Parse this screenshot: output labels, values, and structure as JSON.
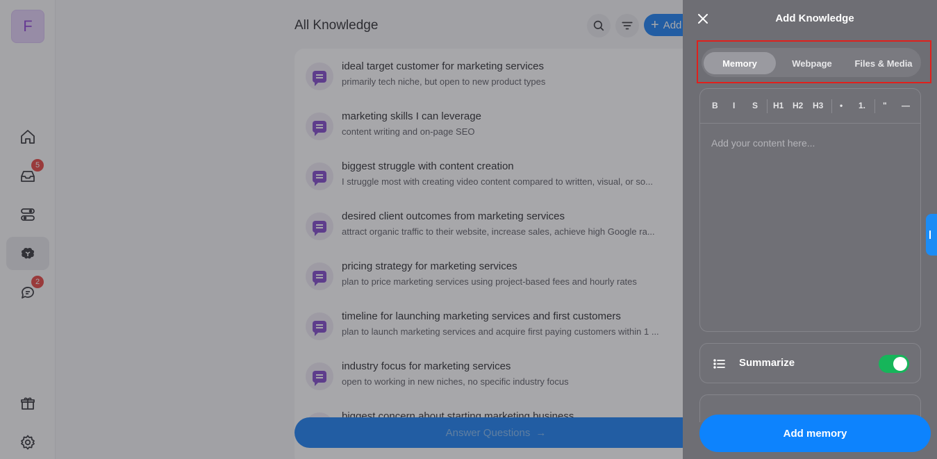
{
  "sidebar": {
    "avatar_letter": "F",
    "nav": [
      {
        "name": "home-icon",
        "badge": ""
      },
      {
        "name": "inbox-icon",
        "badge": "5"
      },
      {
        "name": "tasks-icon",
        "badge": ""
      },
      {
        "name": "brain-icon",
        "badge": "",
        "active": true
      },
      {
        "name": "chat-icon",
        "badge": "2"
      }
    ],
    "bottom": [
      {
        "name": "gift-icon"
      },
      {
        "name": "settings-icon"
      }
    ]
  },
  "main": {
    "title": "All Knowledge",
    "add_label": "Add",
    "items": [
      {
        "title": "ideal target customer for marketing services",
        "subtitle": "primarily tech niche, but open to new product types"
      },
      {
        "title": "marketing skills I can leverage",
        "subtitle": "content writing and on-page SEO"
      },
      {
        "title": "biggest struggle with content creation",
        "subtitle": "I struggle most with creating video content compared to written, visual, or so..."
      },
      {
        "title": "desired client outcomes from marketing services",
        "subtitle": "attract organic traffic to their website, increase sales, achieve high Google ra..."
      },
      {
        "title": "pricing strategy for marketing services",
        "subtitle": "plan to price marketing services using project-based fees and hourly rates"
      },
      {
        "title": "timeline for launching marketing services and first customers",
        "subtitle": "plan to launch marketing services and acquire first paying customers within 1 ..."
      },
      {
        "title": "industry focus for marketing services",
        "subtitle": "open to working in new niches, no specific industry focus"
      },
      {
        "title": "biggest concern about starting marketing business",
        "subtitle": ""
      }
    ],
    "answer_button": "Answer Questions"
  },
  "drawer": {
    "title": "Add Knowledge",
    "tabs": [
      "Memory",
      "Webpage",
      "Files & Media"
    ],
    "active_tab": "Memory",
    "toolbar": [
      "B",
      "I",
      "S",
      "H1",
      "H2",
      "H3",
      "•",
      "1.",
      "\"",
      "—"
    ],
    "placeholder": "Add your content here...",
    "summarize_label": "Summarize",
    "summarize_on": true,
    "submit_label": "Add memory"
  },
  "colors": {
    "accent": "#0d79f2",
    "toggle_on": "#16b55a",
    "highlight": "#e0201c",
    "item_icon": "#7b3fc8"
  }
}
